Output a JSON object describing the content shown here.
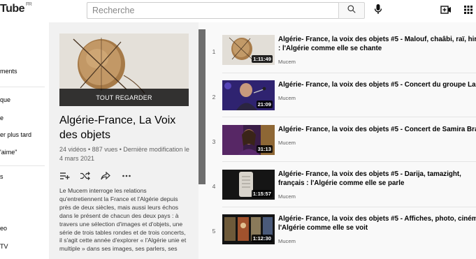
{
  "header": {
    "logo_text": "Tube",
    "logo_region": "FR",
    "search_placeholder": "Recherche",
    "search_icon": "search-icon",
    "mic_icon": "microphone-icon",
    "create_icon": "create-video-icon",
    "apps_icon": "apps-grid-icon"
  },
  "sidebar": {
    "items": [
      {
        "label": "ments"
      },
      {
        "label": "que"
      },
      {
        "label": "e"
      },
      {
        "label": "er plus tard"
      },
      {
        "label": "'aime\""
      },
      {
        "label": "s"
      },
      {
        "label": "eo"
      },
      {
        "label": "TV"
      }
    ]
  },
  "playlist": {
    "play_all_label": "TOUT REGARDER",
    "title": "Algérie-France, La Voix des objets",
    "stats": "24 vidéos • 887 vues • Dernière modification le 4 mars 2021",
    "actions": {
      "save_icon": "add-to-queue-icon",
      "shuffle_icon": "shuffle-icon",
      "share_icon": "share-icon",
      "more_icon": "more-horizontal-icon"
    },
    "description": "Le Mucem interroge les relations qu'entretiennent la France et l'Algérie depuis près de deux siècles, mais aussi leurs échos dans le présent de chacun des deux pays : à travers une sélection d'images et d'objets, une série de trois tables rondes et de trois concerts, il s'agit cette année d'explorer « l'Algérie unie et multiple » dans ses images, ses parlers, ses"
  },
  "videos": [
    {
      "index": "1",
      "title": "Algérie- France, la voix des objets #5 - Malouf, chaâbi, raï, hirak : l'Algérie comme elle se chante",
      "channel": "Mucem",
      "duration": "1:11:49"
    },
    {
      "index": "2",
      "title": "Algérie- France, la voix des objets #5 - Concert du groupe Labess",
      "channel": "Mucem",
      "duration": "21:09"
    },
    {
      "index": "3",
      "title": "Algérie- France, la voix des objets #5 - Concert de Samira Brahmia",
      "channel": "Mucem",
      "duration": "31:13"
    },
    {
      "index": "4",
      "title": "Algérie- France, la voix des objets #5 - Darija, tamazight, français : l'Algérie comme elle se parle",
      "channel": "Mucem",
      "duration": "1:15:57"
    },
    {
      "index": "5",
      "title": "Algérie- France, la voix des objets #5 - Affiches, photo, cinéma : l'Algérie comme elle se voit",
      "channel": "Mucem",
      "duration": "1:12:30"
    }
  ]
}
